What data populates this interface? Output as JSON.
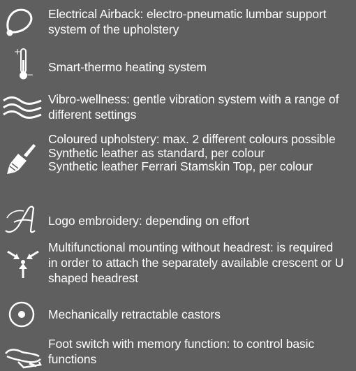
{
  "features": [
    {
      "icon": "airbag-icon",
      "lines": [
        "Electrical Airback: electro-pneumatic lumbar support",
        "system of the upholstery"
      ]
    },
    {
      "icon": "thermometer-icon",
      "lines": [
        "Smart-thermo heating system"
      ]
    },
    {
      "icon": "vibration-waves-icon",
      "lines": [
        "Vibro-wellness: gentle vibration system with a range of",
        "different settings"
      ]
    },
    {
      "icon": "paintbrush-icon",
      "lines": [
        "Coloured upholstery: max. 2 different colours possible",
        "Synthetic leather as standard, per colour",
        "Synthetic leather Ferrari Stamskin Top, per colour"
      ]
    },
    {
      "icon": "script-letter-a-icon",
      "lines": [
        "Logo embroidery: depending on effort"
      ]
    },
    {
      "icon": "mounting-arrows-icon",
      "lines": [
        "Multifunctional mounting without headrest: is required",
        "in order to attach the separately available crescent or U",
        "shaped headrest"
      ]
    },
    {
      "icon": "castor-icon",
      "lines": [
        "Mechanically retractable castors"
      ]
    },
    {
      "icon": "foot-switch-icon",
      "lines": [
        "Foot switch with memory function: to control basic",
        "functions"
      ]
    }
  ],
  "colors": {
    "background": "#5f5f5f",
    "foreground": "#ffffff"
  }
}
